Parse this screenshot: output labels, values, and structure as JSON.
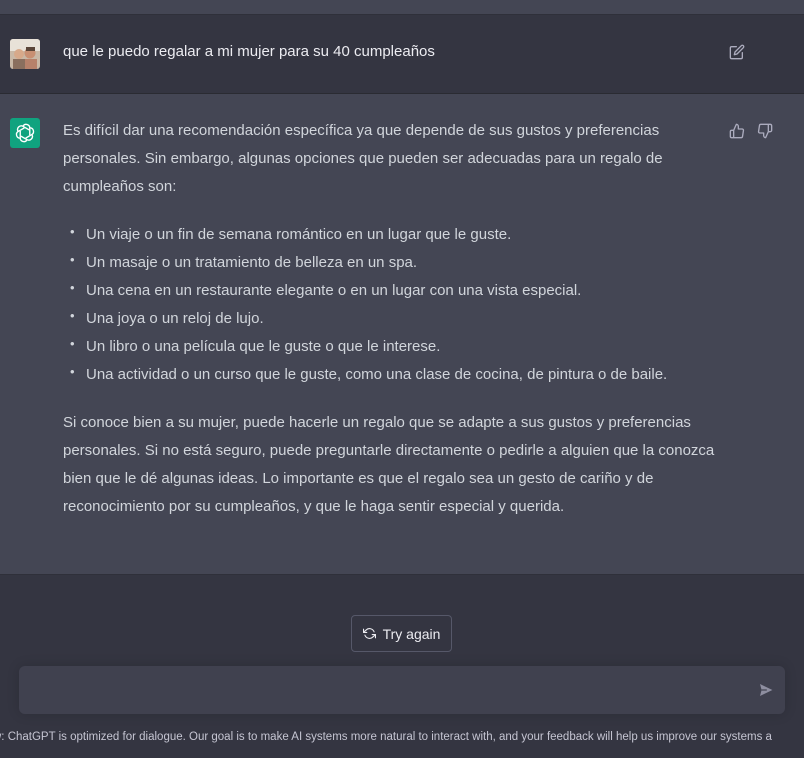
{
  "user_message": {
    "text": "que le puedo regalar a mi mujer para su 40 cumpleaños",
    "avatar_icon": "user-photo-avatar",
    "edit_icon": "edit-icon"
  },
  "assistant_message": {
    "intro": "Es difícil dar una recomendación específica ya que depende de sus gustos y preferencias personales. Sin embargo, algunas opciones que pueden ser adecuadas para un regalo de cumpleaños son:",
    "bullets": [
      "Un viaje o un fin de semana romántico en un lugar que le guste.",
      "Un masaje o un tratamiento de belleza en un spa.",
      "Una cena en un restaurante elegante o en un lugar con una vista especial.",
      "Una joya o un reloj de lujo.",
      "Un libro o una película que le guste o que le interese.",
      "Una actividad o un curso que le guste, como una clase de cocina, de pintura o de baile."
    ],
    "bullet_glyph": "•",
    "closing": "Si conoce bien a su mujer, puede hacerle un regalo que se adapte a sus gustos y preferencias personales. Si no está seguro, puede preguntarle directamente o pedirle a alguien que la conozca bien que le dé algunas ideas. Lo importante es que el regalo sea un gesto de cariño y de reconocimiento por su cumpleaños, y que le haga sentir especial y querida.",
    "avatar_icon": "openai-logo-icon",
    "avatar_color": "#10a37f"
  },
  "actions": {
    "try_again_label": "Try again",
    "try_again_icon": "refresh-icon"
  },
  "composer": {
    "placeholder": "",
    "send_icon": "send-icon"
  },
  "footer": {
    "text": "w: ChatGPT is optimized for dialogue. Our goal is to make AI systems more natural to interact with, and your feedback will help us improve our systems a"
  },
  "colors": {
    "background": "#343541",
    "assistant_bg": "#444654",
    "input_bg": "#40414f",
    "text": "#d1d5db",
    "accent": "#10a37f"
  }
}
